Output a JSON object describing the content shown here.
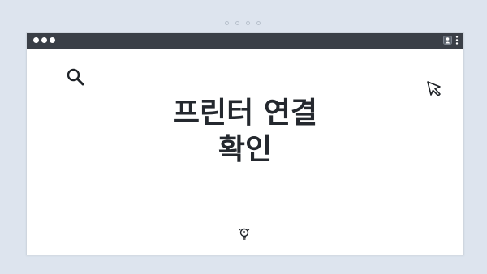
{
  "window": {
    "title_line_1": "프린터 연결",
    "title_line_2": "확인"
  },
  "icons": {
    "top": "pagination-dots",
    "titlebar_left": "window-controls",
    "titlebar_right": [
      "user-icon",
      "kebab-menu-icon"
    ],
    "content": [
      "search-icon",
      "cursor-icon",
      "lightbulb-icon"
    ]
  },
  "colors": {
    "background": "#dde4ee",
    "titlebar": "#3a3f47",
    "window": "#ffffff",
    "title_text": "#24282e"
  }
}
